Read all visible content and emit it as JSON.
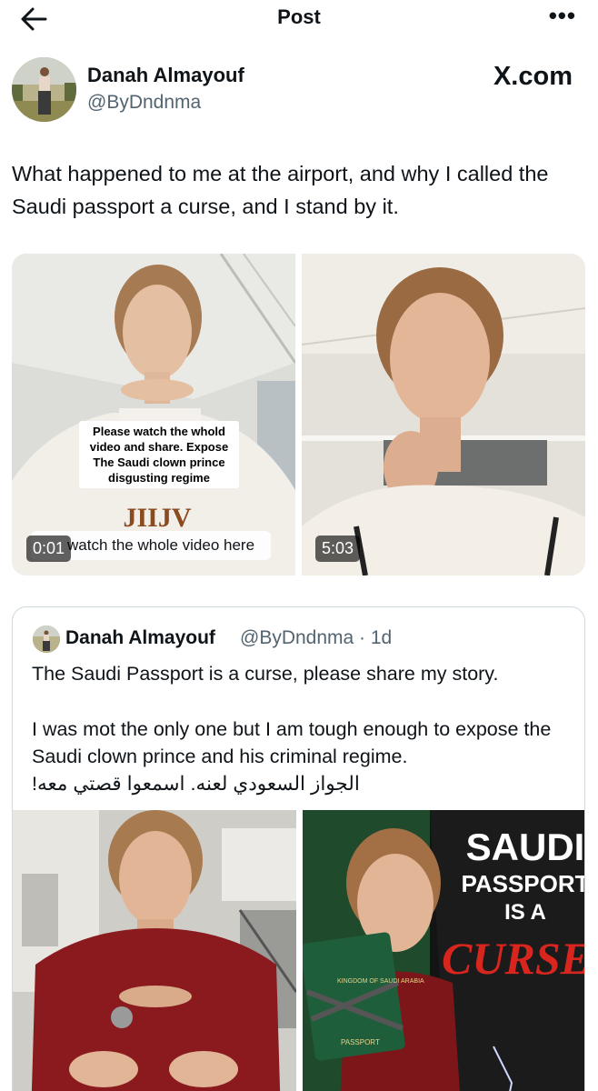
{
  "header": {
    "title": "Post",
    "back_icon": "arrow-left-icon",
    "more_icon": "more-horizontal-icon",
    "more_glyph": "•••"
  },
  "author": {
    "name": "Danah Almayouf",
    "handle": "@ByDndnma",
    "site_label": "X.com"
  },
  "tweet": {
    "text": "What happened to me at the airport, and why I called the Saudi passport a curse, and I stand by it."
  },
  "media": [
    {
      "caption": "Please watch the whold video and share. Expose The Saudi clown prince disgusting regime",
      "bar_text": "watch the whole video here",
      "duration": "0:01"
    },
    {
      "duration": "5:03"
    }
  ],
  "quoted": {
    "name": "Danah Almayouf",
    "handle_time": "@ByDndnma · 1d",
    "line1": "The Saudi Passport is a curse, please share my story.",
    "line2": "I was mot the only one but I am tough enough to expose the Saudi clown prince and his criminal regime.",
    "line3": "الجواز السعودي لعنه. اسمعوا قصتي معه!",
    "thumb_right": {
      "word1": "SAUDI",
      "word2": "PASSPORT",
      "word3": "IS A",
      "word4": "CURSE",
      "passport_label": "PASSPORT",
      "passport_kingdom": "KINGDOM OF SAUDI ARABIA"
    }
  },
  "colors": {
    "text": "#0f1419",
    "secondary": "#536471",
    "border": "#cfd9de",
    "sweater_red": "#8b1a1f",
    "curse_red": "#d8261f",
    "passport_green": "#1f5e3a"
  }
}
